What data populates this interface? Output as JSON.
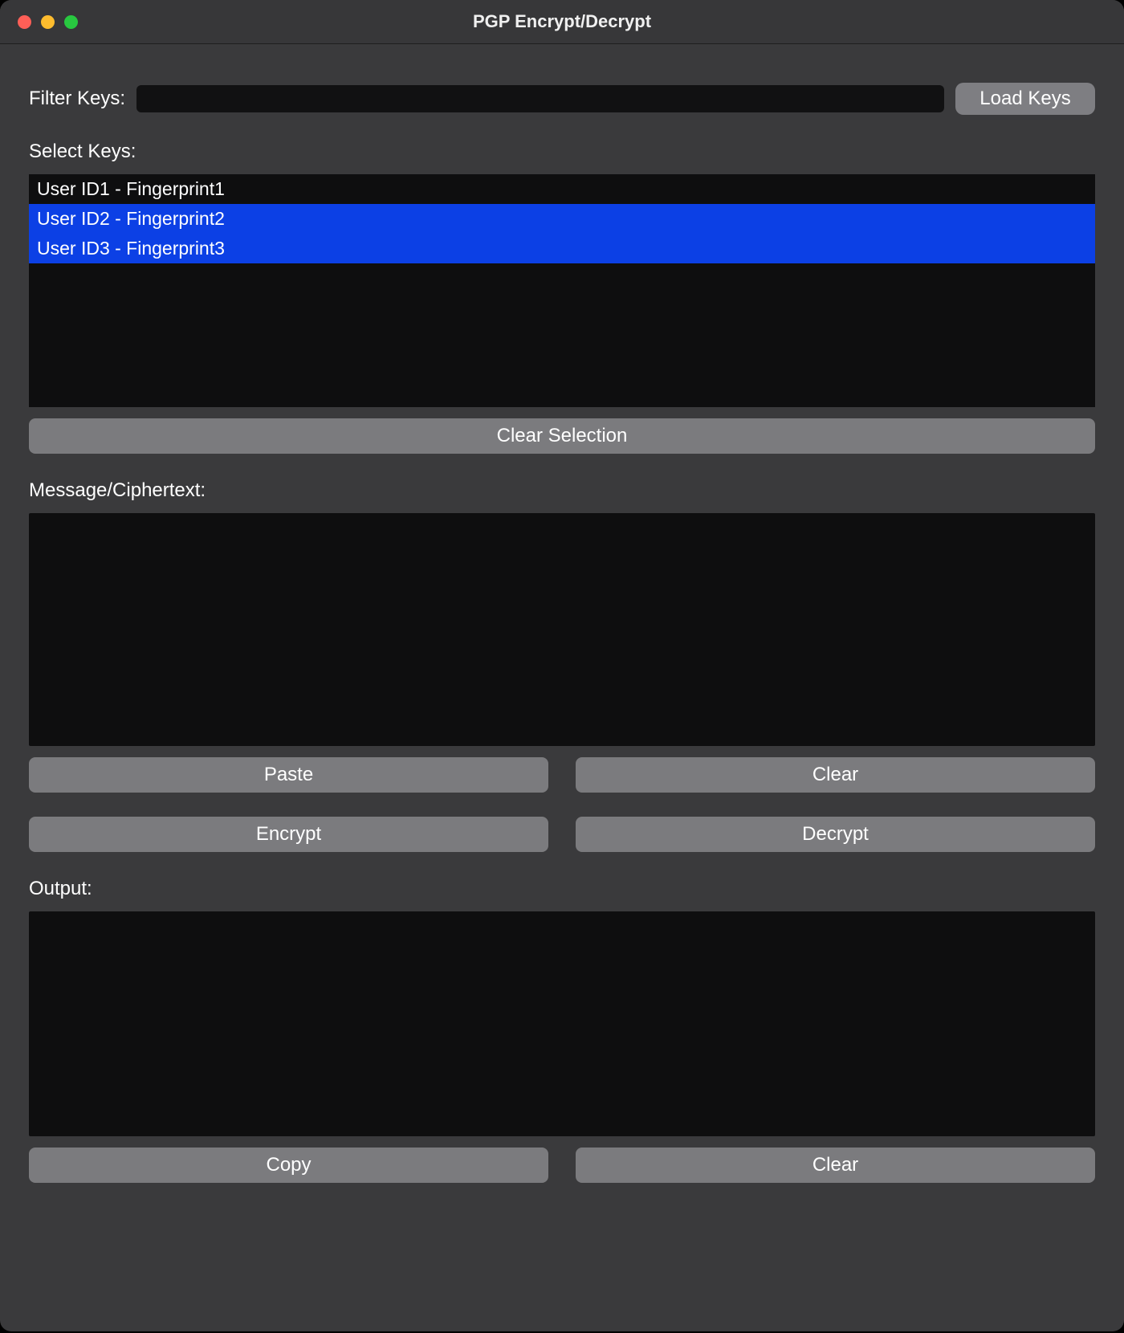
{
  "window": {
    "title": "PGP Encrypt/Decrypt"
  },
  "filter": {
    "label": "Filter Keys:",
    "value": ""
  },
  "loadKeys": {
    "label": "Load Keys"
  },
  "selectKeys": {
    "label": "Select Keys:",
    "items": [
      {
        "label": "User ID1 - Fingerprint1",
        "selected": false
      },
      {
        "label": "User ID2 - Fingerprint2",
        "selected": true
      },
      {
        "label": "User ID3 - Fingerprint3",
        "selected": true
      }
    ]
  },
  "clearSelection": {
    "label": "Clear Selection"
  },
  "message": {
    "label": "Message/Ciphertext:",
    "value": ""
  },
  "paste": {
    "label": "Paste"
  },
  "clearMessage": {
    "label": "Clear"
  },
  "encrypt": {
    "label": "Encrypt"
  },
  "decrypt": {
    "label": "Decrypt"
  },
  "output": {
    "label": "Output:",
    "value": ""
  },
  "copy": {
    "label": "Copy"
  },
  "clearOutput": {
    "label": "Clear"
  }
}
